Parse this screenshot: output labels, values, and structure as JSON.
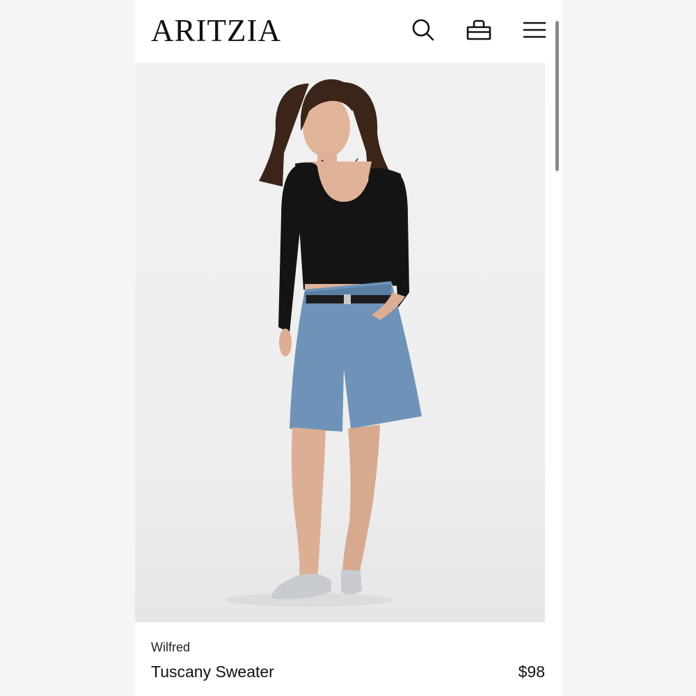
{
  "header": {
    "logo": "ARITZIA",
    "icons": [
      "search-icon",
      "shopping-bag-icon",
      "hamburger-menu-icon"
    ]
  },
  "product": {
    "brand": "Wilfred",
    "name": "Tuscany Sweater",
    "price": "$98"
  },
  "colors": {
    "background": "#ffffff",
    "text": "#111111",
    "scrollbar": "#8a8a8a"
  }
}
